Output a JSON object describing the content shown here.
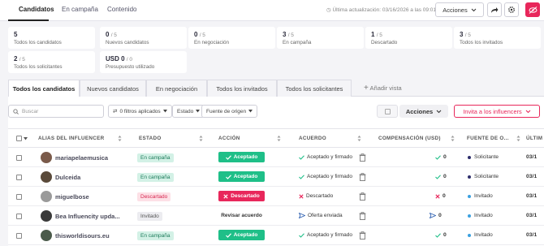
{
  "top_tabs": [
    "Candidatos",
    "En campaña",
    "Contenido"
  ],
  "last_update": "Última actualización: 03/16/2026 a las 09:01",
  "actions_label": "Acciones",
  "stats": [
    {
      "value": "5",
      "total": "",
      "label": "Todos los candidatos"
    },
    {
      "value": "0",
      "total": "/ 5",
      "label": "Nuevos candidatos"
    },
    {
      "value": "0",
      "total": "/ 5",
      "label": "En negociación"
    },
    {
      "value": "3",
      "total": "/ 5",
      "label": "En campaña"
    },
    {
      "value": "1",
      "total": "/ 5",
      "label": "Descartado"
    },
    {
      "value": "3",
      "total": "/ 5",
      "label": "Todos los invitados"
    },
    {
      "value": "2",
      "total": "/ 5",
      "label": "Todos los solicitantes"
    },
    {
      "value": "USD 0",
      "total": "/ 0",
      "label": "Presupuesto utilizado"
    }
  ],
  "view_tabs": [
    "Todos los candidatos",
    "Nuevos candidatos",
    "En negociación",
    "Todos los invitados",
    "Todos los solicitantes"
  ],
  "add_view": "Añadir vista",
  "toolbar": {
    "search_placeholder": "Buscar",
    "filters_applied": "0 filtros aplicados",
    "estado": "Estado",
    "fuente": "Fuente de origen",
    "acciones": "Acciones",
    "invite": "Invita a los influencers"
  },
  "columns": [
    "ALIAS DEL INFLUENCER",
    "ESTADO",
    "ACCIÓN",
    "ACUERDO",
    "COMPENSACIÓN (USD)",
    "FUENTE DE O...",
    "ÚLTIM"
  ],
  "rows": [
    {
      "name": "mariapelaemusica",
      "estado": "En campaña",
      "estado_color": "green",
      "accion": "Aceptado",
      "accion_style": "green",
      "acuerdo": "Aceptado y firmado",
      "acuerdo_icon": "check",
      "comp": "0",
      "comp_icon": "check",
      "fuente": "Solicitante",
      "fuente_color": "#2d2d6b",
      "ultima": "03/1"
    },
    {
      "name": "Dulceida",
      "estado": "En campaña",
      "estado_color": "green",
      "accion": "Aceptado",
      "accion_style": "green",
      "acuerdo": "Aceptado y firmado",
      "acuerdo_icon": "check",
      "comp": "0",
      "comp_icon": "check",
      "fuente": "Solicitante",
      "fuente_color": "#2d2d6b",
      "ultima": "03/1"
    },
    {
      "name": "miguelbose",
      "estado": "Descartado",
      "estado_color": "red",
      "accion": "Descartado",
      "accion_style": "red",
      "acuerdo": "Descartado",
      "acuerdo_icon": "x",
      "comp": "0",
      "comp_icon": "x",
      "fuente": "Invitado",
      "fuente_color": "#3aa0e0",
      "ultima": "03/1"
    },
    {
      "name": "Bea Influencity upda...",
      "estado": "Invitado",
      "estado_color": "gray",
      "accion": "Revisar acuerdo",
      "accion_style": "plain",
      "acuerdo": "Oferta enviada",
      "acuerdo_icon": "send",
      "comp": "0",
      "comp_icon": "send",
      "fuente": "Invitado",
      "fuente_color": "#3aa0e0",
      "ultima": "03/1"
    },
    {
      "name": "thisworldisours.eu",
      "estado": "En campaña",
      "estado_color": "green",
      "accion": "Aceptado",
      "accion_style": "green",
      "acuerdo": "Aceptado y firmado",
      "acuerdo_icon": "check",
      "comp": "0",
      "comp_icon": "check",
      "fuente": "Invitado",
      "fuente_color": "#3aa0e0",
      "ultima": "03/1"
    }
  ],
  "colors": {
    "accent": "#e8275b",
    "success": "#1fbf88",
    "brand_dark": "#2d2d6b"
  }
}
